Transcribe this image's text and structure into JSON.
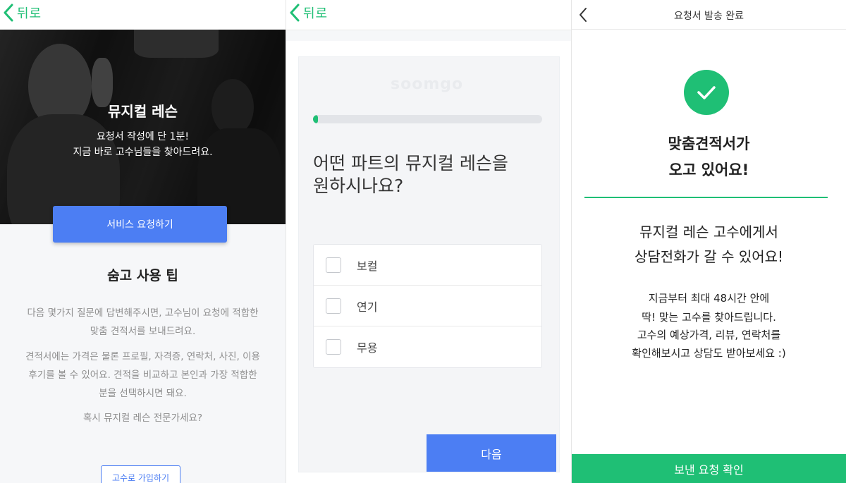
{
  "colors": {
    "accent_green": "#1fbf75",
    "accent_blue": "#4c7ef3"
  },
  "panel1": {
    "back_label": "뒤로",
    "hero": {
      "title": "뮤지컬 레슨",
      "subtitle_line1": "요청서 작성에 단 1분!",
      "subtitle_line2": "지금 바로 고수님들을 찾아드려요."
    },
    "request_button": "서비스 요청하기",
    "tips_title": "숨고 사용 팁",
    "tips": [
      "다음 몇가지 질문에 답변해주시면, 고수님이 요청에 적합한",
      "맞춤 견적서를 보내드려요.",
      "견적서에는 가격은 물론 프로필, 자격증, 연락처, 사진, 이용",
      "후기를 볼 수 있어요. 견적을 비교하고 본인과 가장 적합한",
      "분을 선택하시면 돼요."
    ],
    "expert_question": "혹시 뮤지컬 레슨 전문가세요?",
    "signup_button": "고수로 가입하기"
  },
  "panel2": {
    "back_label": "뒤로",
    "progress": 0.02,
    "question_line1": "어떤 파트의 뮤지컬 레슨을",
    "question_line2": "원하시나요?",
    "options": [
      "보컬",
      "연기",
      "무용"
    ],
    "next_button": "다음"
  },
  "panel3": {
    "title": "요청서 발송 완료",
    "headline_line1": "맞춤견적서가",
    "headline_line2": "오고 있어요!",
    "message_line1": "뮤지컬 레슨 고수에게서",
    "message_line2": "상담전화가 갈 수 있어요!",
    "info_lines": [
      "지금부터 최대 48시간 안에",
      "딱! 맞는 고수를 찾아드립니다.",
      "고수의 예상가격, 리뷰, 연락처를",
      "확인해보시고 상담도 받아보세요 :)"
    ],
    "confirm_button": "보낸 요청 확인"
  }
}
